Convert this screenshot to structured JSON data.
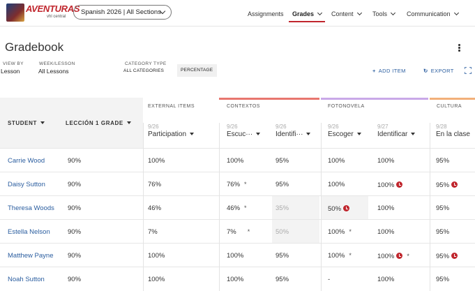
{
  "brand": {
    "name": "AVENTURAS",
    "vendor": "vhl central"
  },
  "course": {
    "label": "Spanish 2026  | All Sections"
  },
  "nav": [
    {
      "label": "Assignments",
      "active": false,
      "has_menu": false
    },
    {
      "label": "Grades",
      "active": true,
      "has_menu": true
    },
    {
      "label": "Content",
      "active": false,
      "has_menu": true
    },
    {
      "label": "Tools",
      "active": false,
      "has_menu": true
    },
    {
      "label": "Communication",
      "active": false,
      "has_menu": true
    }
  ],
  "page": {
    "title": "Gradebook"
  },
  "filters": {
    "view_by": {
      "label": "VIEW BY",
      "value": "Lesson"
    },
    "week_lesson": {
      "label": "WEEK/LESSON",
      "value": "All Lessons"
    },
    "category_type": {
      "label": "CATEGORY TYPE",
      "value": "ALL CATEGORIES"
    },
    "display_mode": "PERCENTAGE"
  },
  "actions": {
    "add_item": "ADD ITEM",
    "export": "EXPORT"
  },
  "table": {
    "student_header": "STUDENT",
    "lesson_header": "LECCIÓN 1 GRADE",
    "categories": [
      {
        "label": "EXTERNAL ITEMS",
        "color": "#ffffff"
      },
      {
        "label": "CONTEXTOS",
        "color": "#e8766f"
      },
      {
        "label": "FOTONOVELA",
        "color": "#c9a8e8"
      },
      {
        "label": "CULTURA",
        "color": "#f2b07a"
      }
    ],
    "columns": [
      {
        "date": "9/26",
        "name": "Participation"
      },
      {
        "date": "9/26",
        "name": "Escuc···"
      },
      {
        "date": "9/26",
        "name": "Identifi···"
      },
      {
        "date": "9/26",
        "name": "Escoger"
      },
      {
        "date": "9/27",
        "name": "Identificar"
      },
      {
        "date": "9/28",
        "name": "En la clase"
      }
    ],
    "rows": [
      {
        "student": "Carrie Wood",
        "lesson": "90%",
        "cells": [
          "100%",
          "100%",
          "95%",
          "100%",
          "100%",
          "95%"
        ]
      },
      {
        "student": "Daisy Sutton",
        "lesson": "90%",
        "cells": [
          "76%",
          "76%",
          "95%",
          "100%",
          "100%",
          "95%"
        ]
      },
      {
        "student": "Theresa Woods",
        "lesson": "90%",
        "cells": [
          "46%",
          "46%",
          "35%",
          "50%",
          "100%",
          "95%"
        ]
      },
      {
        "student": "Estella Nelson",
        "lesson": "90%",
        "cells": [
          "7%",
          "7%",
          "50%",
          "100%",
          "100%",
          "95%"
        ]
      },
      {
        "student": "Matthew Payne",
        "lesson": "90%",
        "cells": [
          "100%",
          "100%",
          "95%",
          "100%",
          "100%",
          "95%"
        ]
      },
      {
        "student": "Noah Sutton",
        "lesson": "90%",
        "cells": [
          "100%",
          "100%",
          "95%",
          "-",
          "100%",
          "95%"
        ]
      }
    ]
  },
  "markers": {
    "star": "*"
  }
}
